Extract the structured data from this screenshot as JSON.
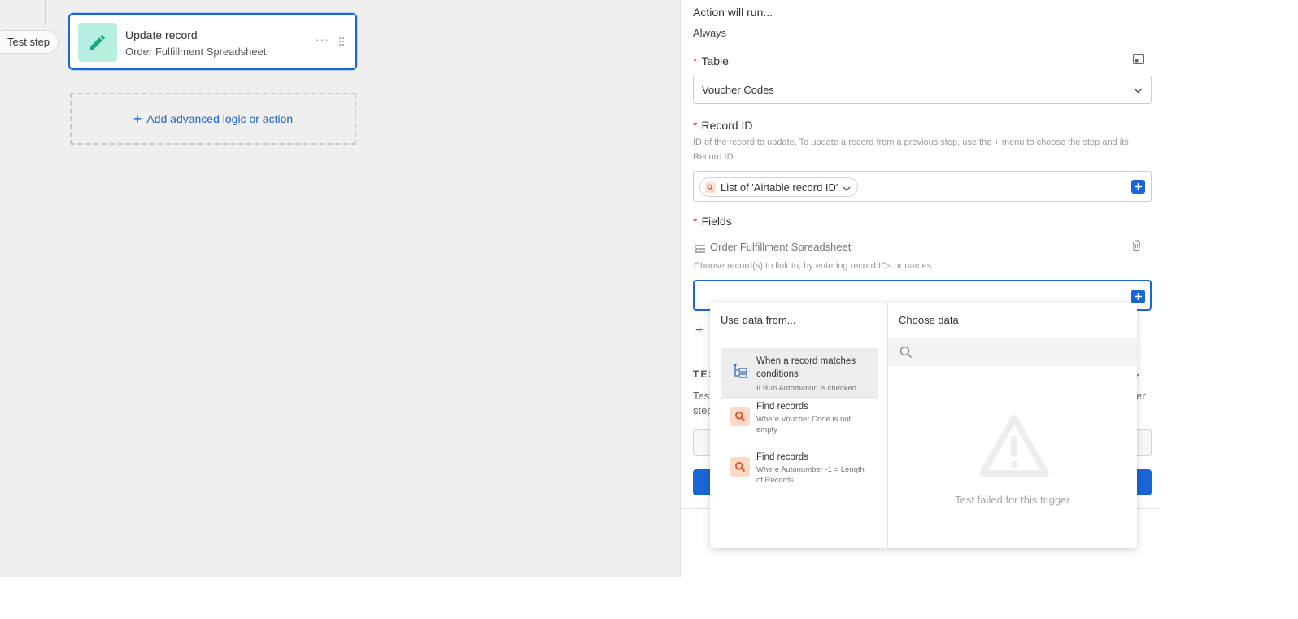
{
  "canvas": {
    "test_step_label": "Test step",
    "step_card": {
      "title": "Update record",
      "subtitle": "Order Fulfillment Spreadsheet",
      "more_label": "···"
    },
    "add_logic_label": "Add advanced logic or action"
  },
  "panel": {
    "run_condition_label": "Action will run...",
    "run_condition_value": "Always",
    "table": {
      "label": "Table",
      "value": "Voucher Codes"
    },
    "record_id": {
      "label": "Record ID",
      "help_line1": "ID of the record to update. To update a record from a previous step, use the + menu to choose the step and its",
      "help_line2": "Record ID.",
      "chip_label": "List of 'Airtable record ID'"
    },
    "fields": {
      "label": "Fields",
      "field_name": "Order Fulfillment Spreadsheet",
      "field_help": "Choose record(s) to link to, by entering record IDs or names"
    },
    "test": {
      "label": "TES",
      "desc_start": "Test",
      "desc_line2": "step",
      "desc_end": "er"
    }
  },
  "popover": {
    "left_header": "Use data from...",
    "right_header": "Choose data",
    "sources": [
      {
        "title": "When a record matches conditions",
        "desc": "If Run Automation is checked",
        "icon": "trigger-icon",
        "active": true
      },
      {
        "title": "Find records",
        "desc": "Where Voucher Code is not empty",
        "icon": "search-icon",
        "active": false
      },
      {
        "title": "Find records",
        "desc": "Where Autonumber -1 = Length of Records",
        "icon": "search-icon",
        "active": false
      }
    ],
    "empty_message": "Test failed for this trigger"
  },
  "colors": {
    "accent": "#1a66d6",
    "required": "#d63b3b",
    "step_icon_bg": "#b7efe0",
    "step_icon_fg": "#1aa889",
    "find_icon_bg": "#fdd9c7",
    "find_icon_fg": "#e4572e"
  }
}
